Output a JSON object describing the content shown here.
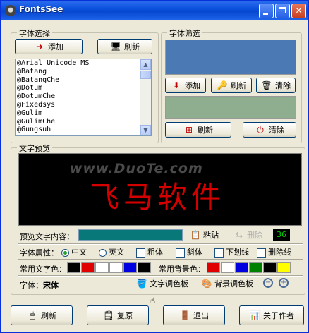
{
  "window": {
    "title": "FontsSee"
  },
  "font_select": {
    "title": "字体选择",
    "add_label": "添加",
    "refresh_label": "刷新",
    "fonts": [
      "@Arial Unicode MS",
      "@Batang",
      "@BatangChe",
      "@Dotum",
      "@DotumChe",
      "@Fixedsys",
      "@Gulim",
      "@GulimChe",
      "@Gungsuh"
    ]
  },
  "font_filter": {
    "title": "字体筛选",
    "add_label": "添加",
    "refresh_label": "刷新",
    "clear_label": "清除",
    "refresh2_label": "刷新",
    "clear2_label": "清除",
    "colors": {
      "top_panel": "#4a79b4",
      "bottom_panel": "#8fae90"
    }
  },
  "preview": {
    "title": "文字预览",
    "watermark": "www.DuoTe.com",
    "sample_text": "飞马软件",
    "content_label": "预览文字内容：",
    "paste_label": "粘贴",
    "delete_label": "删除",
    "size_value": "36",
    "attr_label": "字体属性：",
    "lang_cn": "中文",
    "lang_en": "英文",
    "bold": "粗体",
    "italic": "斜体",
    "underline": "下划线",
    "strike": "删除线",
    "text_colors_label": "常用文字色：",
    "bg_colors_label": "常用背景色：",
    "text_colors": [
      "#000000",
      "#e00000",
      "#ffffff",
      "#ffffff",
      "#0000e0",
      "#000000"
    ],
    "bg_colors": [
      "#e00000",
      "#ffffff",
      "#0000e0",
      "#008000",
      "#000000",
      "#ffff00"
    ],
    "font_label": "字体：",
    "font_name": "宋体",
    "text_palette_label": "文字调色板",
    "bg_palette_label": "背景调色板"
  },
  "bottom": {
    "refresh_label": "刷新",
    "restore_label": "复原",
    "exit_label": "退出",
    "about_label": "关于作者"
  }
}
